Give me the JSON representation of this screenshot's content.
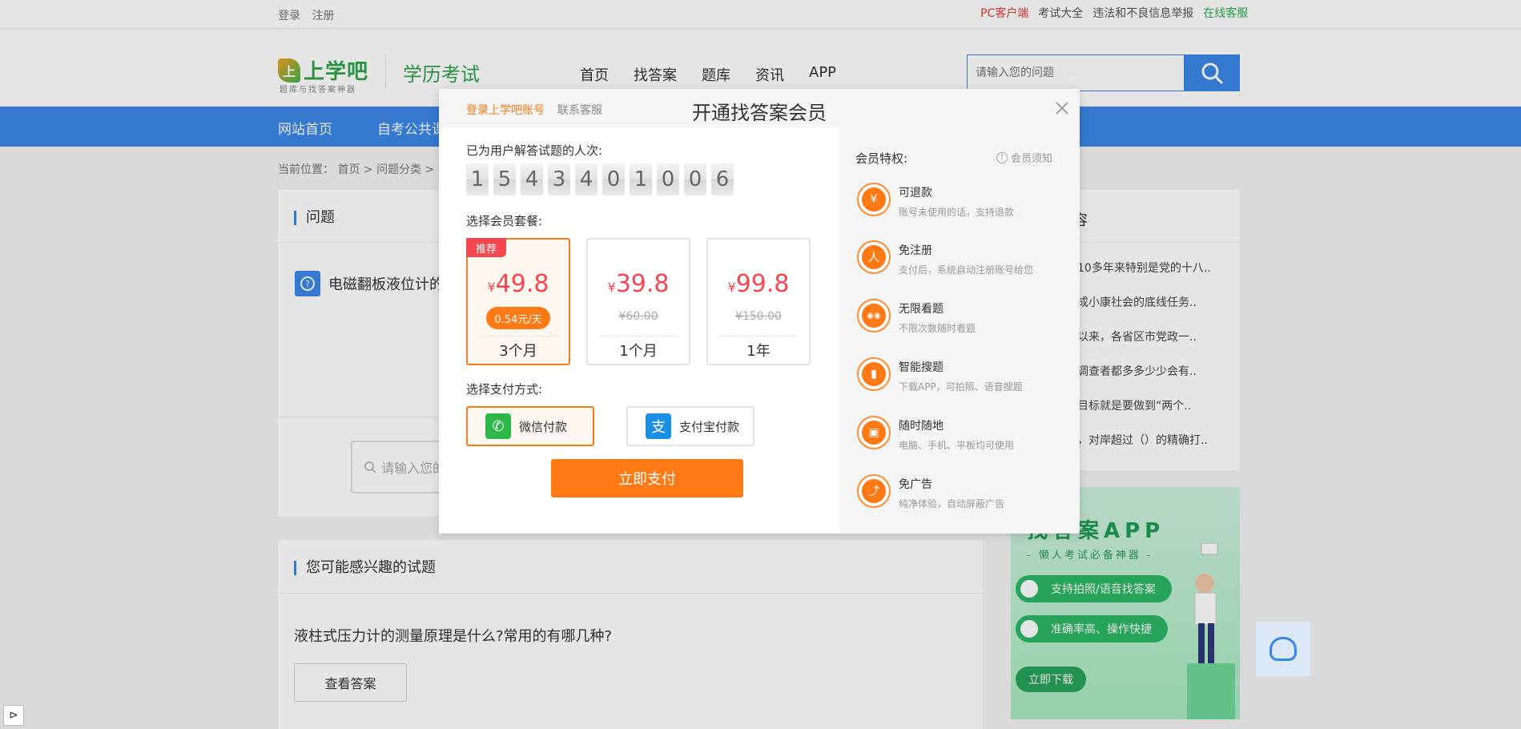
{
  "topbar": {
    "login": "登录",
    "register": "注册",
    "pc_client": "PC客户端",
    "exam_all": "考试大全",
    "report": "违法和不良信息举报",
    "online_service": "在线客服"
  },
  "header": {
    "logo_mark": "上",
    "logo_text": "上学吧",
    "logo_sub": "题库与找答案神器",
    "exam_title": "学历考试",
    "nav": [
      "首页",
      "找答案",
      "题库",
      "资讯",
      "APP"
    ],
    "search_placeholder": "请输入您的问题"
  },
  "blue_nav": [
    "网站首页",
    "自考公共课"
  ],
  "breadcrumb": "当前位置：  首页   >   问题分类   >",
  "question_panel": {
    "heading": "问题",
    "question_text": "电磁翻板液位计的",
    "answer_input_placeholder": "请输入您的"
  },
  "related_panel": {
    "heading": "您可能感兴趣的试题",
    "question": "液柱式压力计的测量原理是什么?常用的有哪几种?",
    "view_answer": "查看答案"
  },
  "right_column": {
    "heading_tail": "容",
    "items": [
      "10多年来特别是党的十八..",
      "成小康社会的底线任务..",
      "以来，各省区市党政一..",
      "调查者都多多少少会有..",
      "目标就是要做到“两个..",
      "，对岸超过（）的精确打.."
    ]
  },
  "app_ad": {
    "title": "找答案APP",
    "slogan": "- 懒人考试必备神器 -",
    "feature1": "支持拍照/语音找答案",
    "feature2": "准确率高、操作快捷",
    "download": "立即下载"
  },
  "modal": {
    "login_link": "登录上学吧账号",
    "contact": "联系客服",
    "title": "开通找答案会员",
    "count_label": "已为用户解答试题的人次:",
    "digits": [
      "1",
      "5",
      "4",
      "3",
      "4",
      "0",
      "1",
      "0",
      "0",
      "6"
    ],
    "plan_label": "选择会员套餐:",
    "plans": [
      {
        "badge": "推荐",
        "currency": "¥",
        "price": "49.8",
        "daily": "0.54元/天",
        "period": "3个月"
      },
      {
        "currency": "¥",
        "price": "39.8",
        "original": "¥60.00",
        "period": "1个月"
      },
      {
        "currency": "¥",
        "price": "99.8",
        "original": "¥150.00",
        "period": "1年"
      }
    ],
    "pay_label": "选择支付方式:",
    "pay_wechat": "微信付款",
    "pay_alipay": "支付宝付款",
    "pay_button": "立即支付",
    "privileges_title": "会员特权:",
    "member_notice": "会员须知",
    "privileges": [
      {
        "icon": "refund-icon",
        "glyph": "¥",
        "title": "可退款",
        "desc": "账号未使用的话，支持退款"
      },
      {
        "icon": "no-register-icon",
        "glyph": "人",
        "title": "免注册",
        "desc": "支付后，系统自动注册账号给您"
      },
      {
        "icon": "unlimited-view-icon",
        "glyph": "◉◉",
        "title": "无限看题",
        "desc": "不限次数随时看题"
      },
      {
        "icon": "smart-search-icon",
        "glyph": "▮",
        "title": "智能搜题",
        "desc": "下载APP，可拍照、语音搜题"
      },
      {
        "icon": "anywhere-icon",
        "glyph": "▣",
        "title": "随时随地",
        "desc": "电脑、手机、平板均可使用"
      },
      {
        "icon": "no-ads-icon",
        "glyph": "⤴",
        "title": "免广告",
        "desc": "纯净体验，自动屏蔽广告"
      }
    ]
  },
  "colors": {
    "brand_green": "#2ea34b",
    "primary_blue": "#3a86e8",
    "accent_orange": "#ff7a14",
    "price_red": "#f5474f"
  }
}
